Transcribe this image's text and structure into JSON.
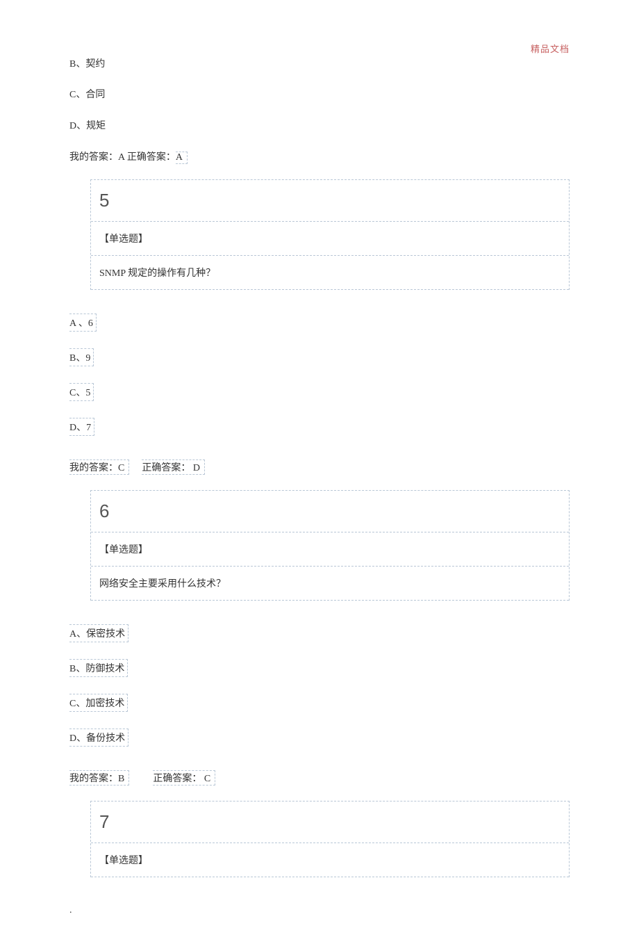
{
  "header": {
    "mark": "精品文档"
  },
  "opts_pre": {
    "b": "B、契约",
    "c": "C、合同",
    "d": "D、规矩"
  },
  "ans4": {
    "my_label": "我的答案：",
    "my_val": "A",
    "correct_label": "正确答案：",
    "correct_val": " A"
  },
  "q5": {
    "num": "5",
    "type": "【单选题】",
    "text": "SNMP 规定的操作有几种？",
    "opts": {
      "a": "A 、6",
      "b": "B、9",
      "c": "C、5",
      "d": "D、7"
    },
    "ans": {
      "my": "我的答案：C",
      "correct": "正确答案：  D"
    }
  },
  "q6": {
    "num": "6",
    "type": "【单选题】",
    "text": "网络安全主要采用什么技术？",
    "opts": {
      "a": "A、保密技术",
      "b": "B、防御技术",
      "c": "C、加密技术",
      "d": "D、备份技术"
    },
    "ans": {
      "my": "我的答案：B",
      "correct": "正确答案：  C"
    }
  },
  "q7": {
    "num": "7",
    "type": "【单选题】"
  },
  "footer": {
    "dot": "."
  }
}
